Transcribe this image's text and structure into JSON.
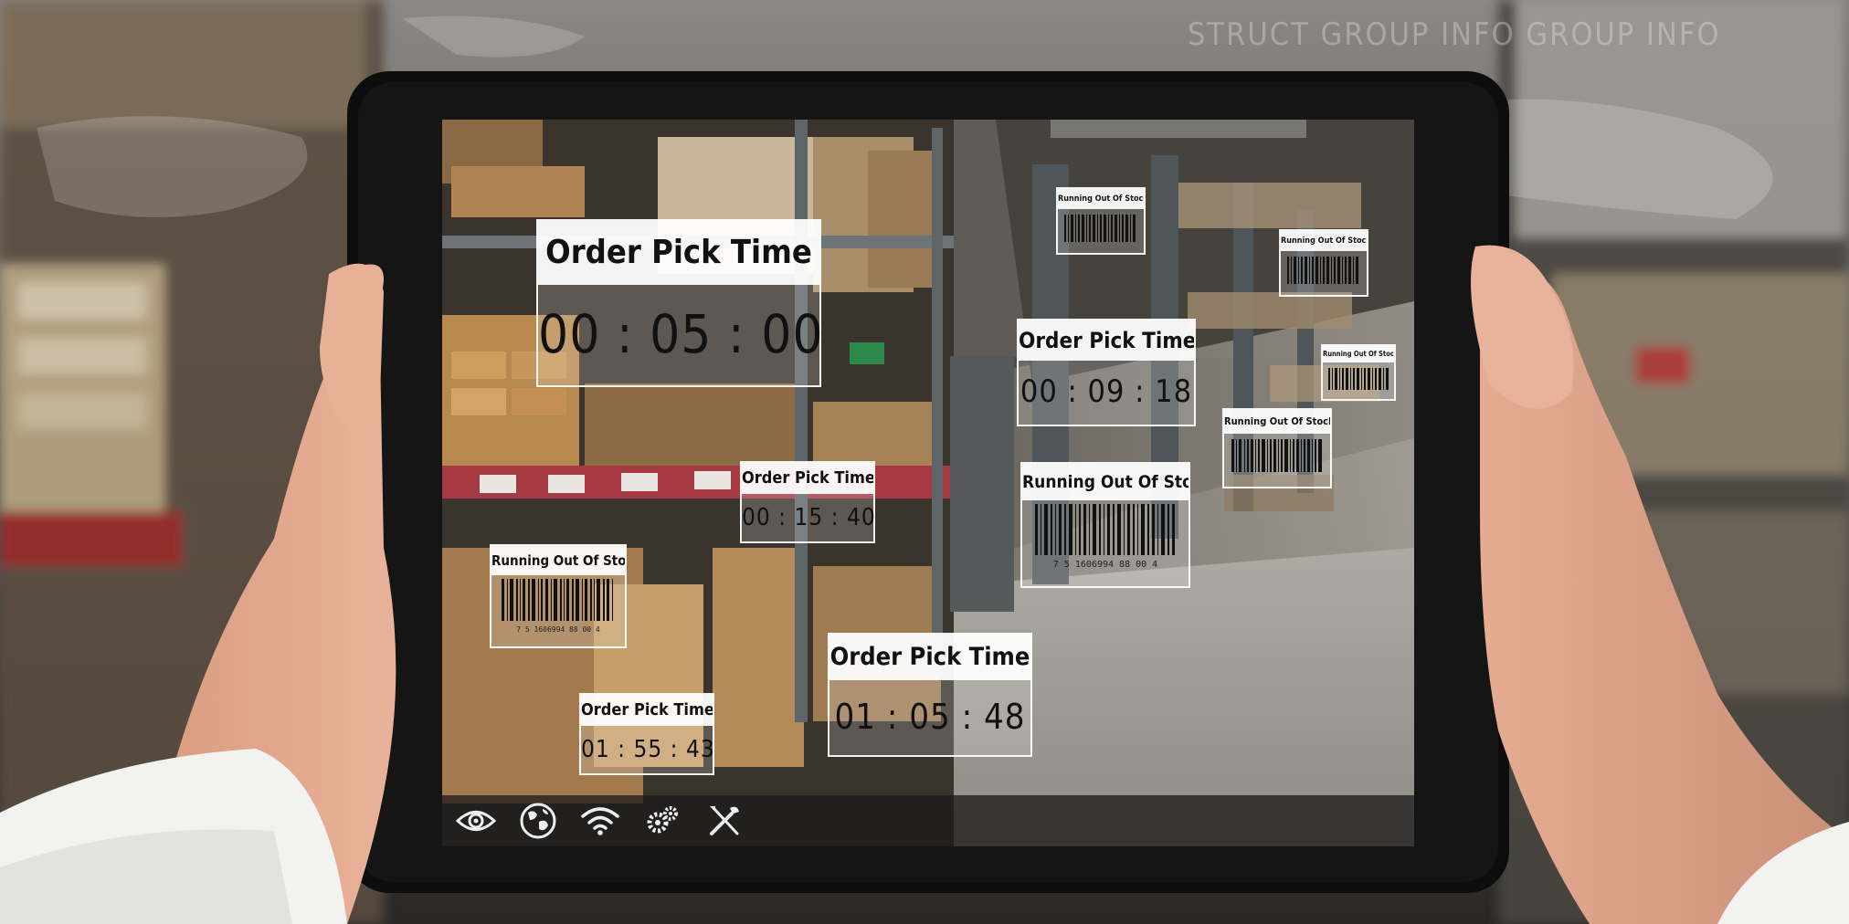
{
  "background_text": "STRUCT GROUP INFO  GROUP INFO",
  "widgets": {
    "pick_1": {
      "label": "Order Pick Time",
      "time": "00 : 05 : 00"
    },
    "pick_2": {
      "label": "Order Pick Time",
      "time": "00 : 09 : 18"
    },
    "pick_3": {
      "label": "Order Pick Time",
      "time": "00 : 15 : 40"
    },
    "pick_4": {
      "label": "Order Pick Time",
      "time": "01 : 05 : 48"
    },
    "pick_5": {
      "label": "Order Pick Time",
      "time": "01 : 55 : 43"
    },
    "stock_1": {
      "label": "Running Out Of Stock",
      "code": "7 5 1606994 88 00 4"
    },
    "stock_2": {
      "label": "Running Out Of Stock",
      "code": "7 5 1606994 88 00 4"
    },
    "stock_3": {
      "label": "Running Out Of Stock"
    },
    "stock_4": {
      "label": "Running Out Of Stock"
    },
    "stock_5": {
      "label": "Running Out Of Stock"
    },
    "stock_6": {
      "label": "Running Out Of Stock"
    }
  },
  "toolbar": {
    "icons": [
      "eye-icon",
      "globe-icon",
      "wifi-icon",
      "gears-icon",
      "tools-icon"
    ]
  },
  "colors": {
    "overlay_white": "#ffffff",
    "tablet_frame": "#0d0d0d"
  }
}
